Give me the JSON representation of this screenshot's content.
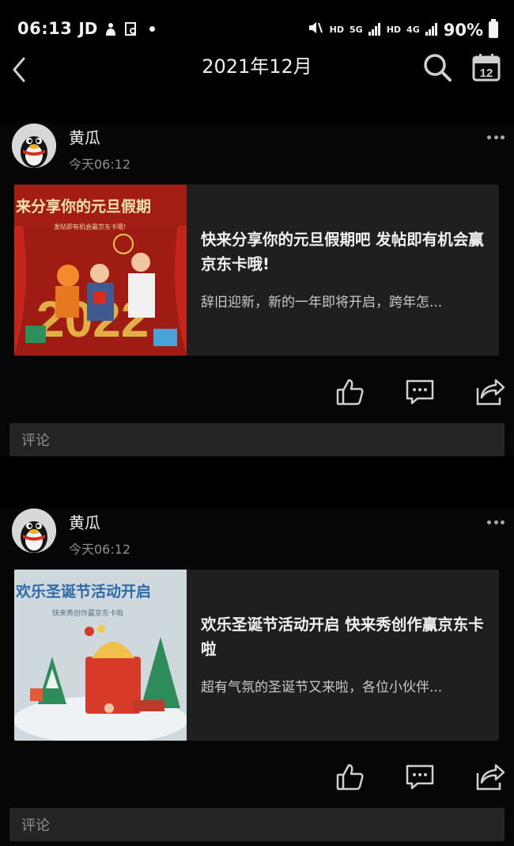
{
  "status_bar": {
    "time": "06:13",
    "app_label": "JD",
    "hd1": "HD",
    "net5g": "5G",
    "hd2": "HD",
    "net4g": "4G",
    "battery": "90%"
  },
  "header": {
    "title": "2021年12月",
    "calendar_day": "12"
  },
  "posts": [
    {
      "author": "黄瓜",
      "time": "今天06:12",
      "link_title": "快来分享你的元旦假期吧 发帖即有机会赢京东卡哦!",
      "link_desc": "辞旧迎新，新的一年即将开启，跨年怎...",
      "thumb_heading": "来分享你的元旦假期",
      "thumb_sub": "发帖即有机会赢京东卡哦!",
      "thumb_year": "2022",
      "comment_placeholder": "评论"
    },
    {
      "author": "黄瓜",
      "time": "今天06:12",
      "link_title": "欢乐圣诞节活动开启 快来秀创作赢京东卡啦",
      "link_desc": "超有气氛的圣诞节又来啦，各位小伙伴...",
      "thumb_heading": "欢乐圣诞节活动开启",
      "thumb_sub": "快来秀创作赢京东卡啦",
      "comment_placeholder": "评论"
    }
  ],
  "colors": {
    "background": "#000000",
    "card": "#1f1f1f",
    "comment_box": "#242424",
    "text_primary": "#f2f2f2",
    "text_secondary": "#8e8e8e"
  }
}
